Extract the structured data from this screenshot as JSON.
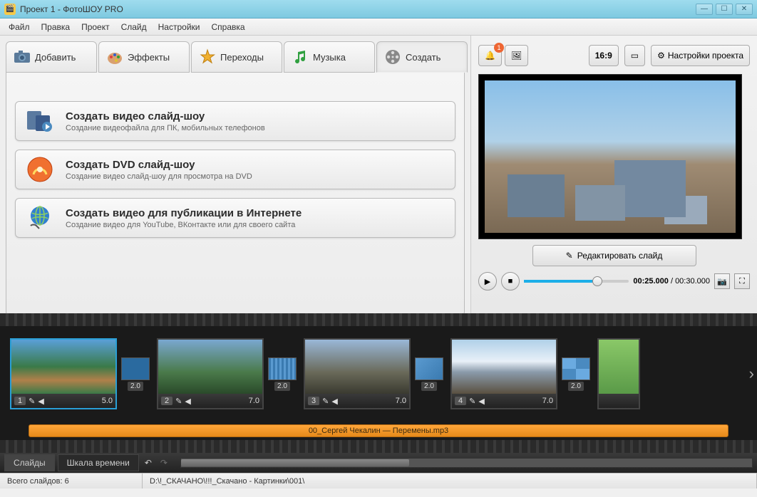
{
  "window": {
    "title": "Проект 1 - ФотоШОУ PRO"
  },
  "menu": [
    "Файл",
    "Правка",
    "Проект",
    "Слайд",
    "Настройки",
    "Справка"
  ],
  "tabs": [
    {
      "label": "Добавить"
    },
    {
      "label": "Эффекты"
    },
    {
      "label": "Переходы"
    },
    {
      "label": "Музыка"
    },
    {
      "label": "Создать"
    }
  ],
  "create_options": [
    {
      "title": "Создать видео слайд-шоу",
      "desc": "Создание видеофайла для ПК, мобильных телефонов"
    },
    {
      "title": "Создать DVD слайд-шоу",
      "desc": "Создание видео слайд-шоу для просмотра на DVD"
    },
    {
      "title": "Создать видео для публикации в Интернете",
      "desc": "Создание видео для YouTube, ВКонтакте или для своего сайта"
    }
  ],
  "toolbar": {
    "notifications": "1",
    "aspect": "16:9",
    "settings_label": "Настройки проекта"
  },
  "preview": {
    "edit_label": "Редактировать слайд",
    "time_current": "00:25.000",
    "time_total": "00:30.000"
  },
  "timeline": {
    "slides": [
      {
        "num": "1",
        "dur": "5.0",
        "trans": "2.0"
      },
      {
        "num": "2",
        "dur": "7.0",
        "trans": "2.0"
      },
      {
        "num": "3",
        "dur": "7.0",
        "trans": "2.0"
      },
      {
        "num": "4",
        "dur": "7.0",
        "trans": "2.0"
      }
    ],
    "audio_track": "00_Сергей Чекалин — Перемены.mp3",
    "tab_slides": "Слайды",
    "tab_timeline": "Шкала времени"
  },
  "status": {
    "total_label": "Всего слайдов: 6",
    "path": "D:\\!_СКАЧАНО\\!!!_Скачано - Картинки\\001\\"
  }
}
